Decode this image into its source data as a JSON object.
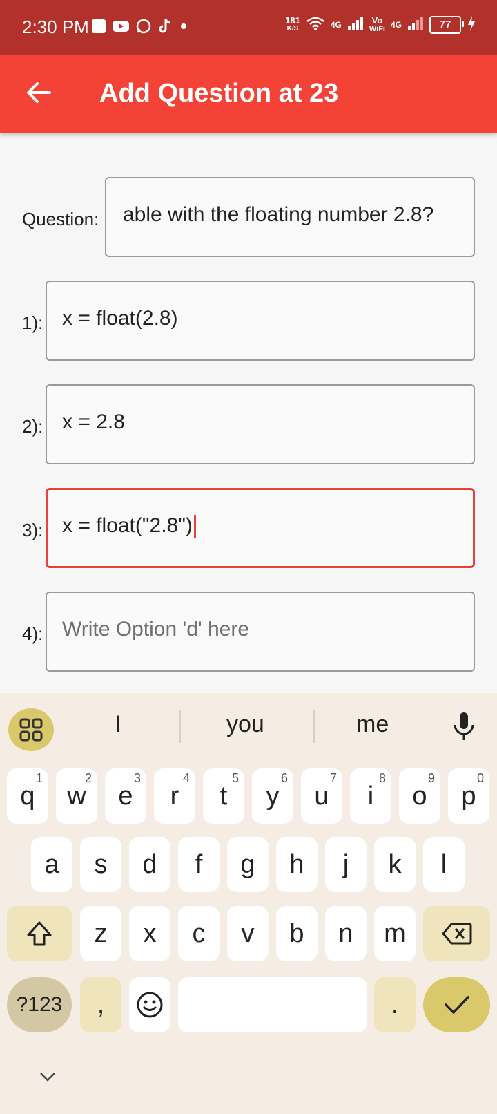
{
  "status_bar": {
    "time": "2:30 PM",
    "net_speed_value": "181",
    "net_speed_unit": "K/S",
    "sim1": "4G",
    "volte": "Vo",
    "wifi_label": "WiFi",
    "sim2": "4G",
    "battery": "77"
  },
  "app_bar": {
    "title": "Add Question at 23"
  },
  "form": {
    "question": {
      "label": "Question:",
      "value": "able with the floating number 2.8?"
    },
    "options": [
      {
        "label": "1):",
        "value": "x = float(2.8)"
      },
      {
        "label": "2):",
        "value": "x = 2.8"
      },
      {
        "label": "3):",
        "value": "x = float(\"2.8\")"
      },
      {
        "label": "4):",
        "value": "",
        "placeholder": "Write Option 'd' here"
      }
    ]
  },
  "keyboard": {
    "suggestions": [
      "I",
      "you",
      "me"
    ],
    "row1": [
      {
        "key": "q",
        "sup": "1"
      },
      {
        "key": "w",
        "sup": "2"
      },
      {
        "key": "e",
        "sup": "3"
      },
      {
        "key": "r",
        "sup": "4"
      },
      {
        "key": "t",
        "sup": "5"
      },
      {
        "key": "y",
        "sup": "6"
      },
      {
        "key": "u",
        "sup": "7"
      },
      {
        "key": "i",
        "sup": "8"
      },
      {
        "key": "o",
        "sup": "9"
      },
      {
        "key": "p",
        "sup": "0"
      }
    ],
    "row2": [
      "a",
      "s",
      "d",
      "f",
      "g",
      "h",
      "j",
      "k",
      "l"
    ],
    "row3": [
      "z",
      "x",
      "c",
      "v",
      "b",
      "n",
      "m"
    ],
    "symbols_key": "?123",
    "comma_key": ",",
    "period_key": "."
  },
  "colors": {
    "status_bar": "#b3312b",
    "app_bar": "#f44236",
    "focus": "#e74338",
    "keyboard_bg": "#f5ede3",
    "accent_key": "#d9c96a"
  }
}
